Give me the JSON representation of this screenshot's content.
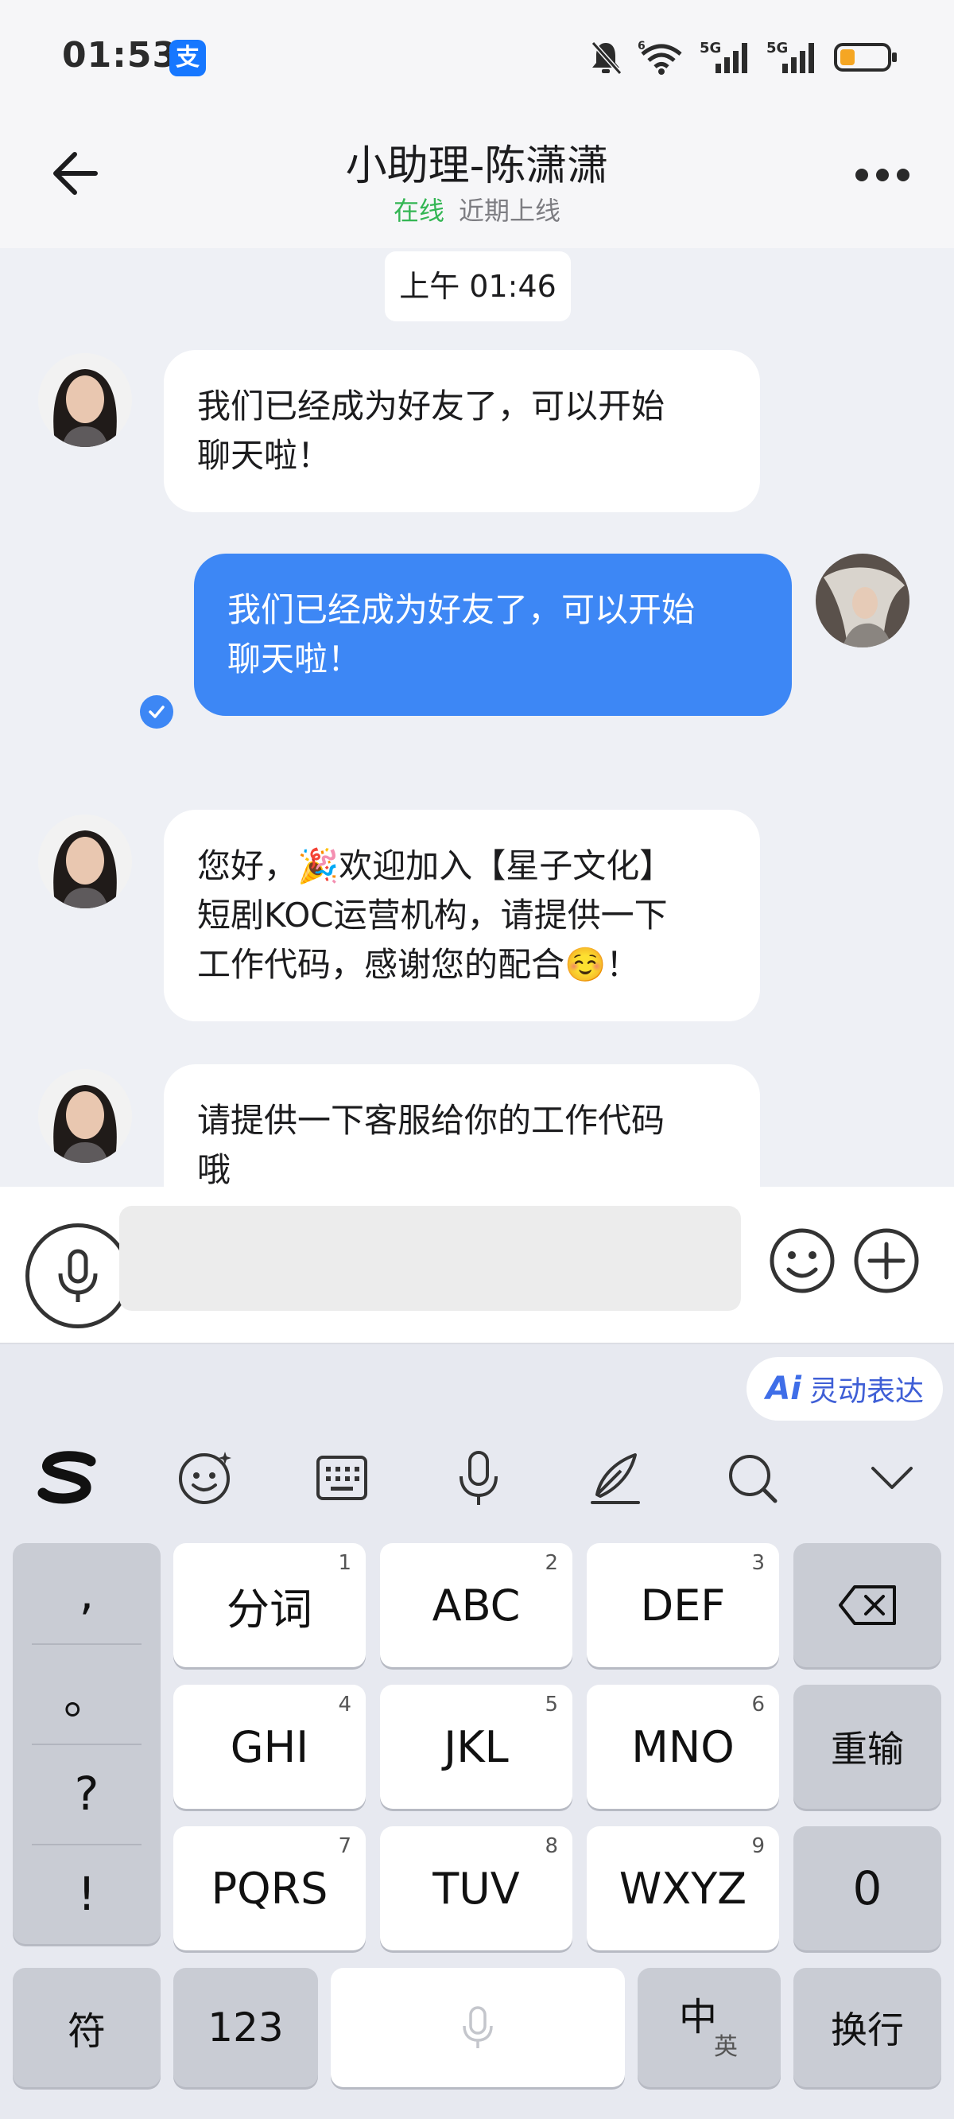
{
  "status_bar": {
    "time": "01:53",
    "app_badge": "支",
    "signal_1": "5G",
    "signal_2": "5G",
    "wifi_badge": "6"
  },
  "header": {
    "title": "小助理-陈潇潇",
    "online": "在线",
    "recent": "近期上线"
  },
  "chat": {
    "timestamp": "上午 01:46",
    "messages": [
      {
        "side": "in",
        "lines": [
          "我们已经成为好友了，可以开始",
          "聊天啦！"
        ]
      },
      {
        "side": "out",
        "lines": [
          "我们已经成为好友了，可以开始",
          "聊天啦！"
        ]
      },
      {
        "side": "in",
        "lines": [
          "您好，🎉欢迎加入【星子文化】",
          "短剧KOC运营机构，请提供一下",
          "工作代码，感谢您的配合☺️！"
        ]
      },
      {
        "side": "in",
        "lines": [
          "请提供一下客服给你的工作代码",
          "哦"
        ]
      }
    ]
  },
  "input": {
    "placeholder": ""
  },
  "keyboard": {
    "ai_label": "Ai",
    "ai_text": "灵动表达",
    "toolbar": [
      "sogou-logo",
      "emoji-icon",
      "keyboard-icon",
      "microphone-icon",
      "pen-icon",
      "search-icon",
      "chevron-down-icon"
    ],
    "punct": [
      ",",
      "。",
      "?",
      "!"
    ],
    "keys": [
      {
        "label": "分词",
        "num": "1"
      },
      {
        "label": "ABC",
        "num": "2"
      },
      {
        "label": "DEF",
        "num": "3"
      },
      {
        "label": "GHI",
        "num": "4"
      },
      {
        "label": "JKL",
        "num": "5"
      },
      {
        "label": "MNO",
        "num": "6"
      },
      {
        "label": "PQRS",
        "num": "7"
      },
      {
        "label": "TUV",
        "num": "8"
      },
      {
        "label": "WXYZ",
        "num": "9"
      }
    ],
    "reinput": "重输",
    "zero": "0",
    "symbols": "符",
    "numbers": "123",
    "lang_main": "中",
    "lang_alt": "英",
    "enter": "换行"
  }
}
